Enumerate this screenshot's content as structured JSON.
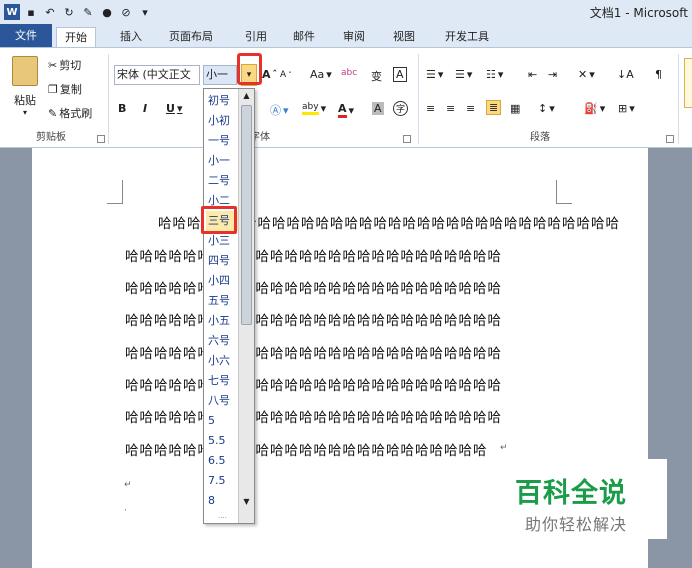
{
  "window": {
    "title": "文档1 - Microsoft"
  },
  "tabs": [
    "文件",
    "开始",
    "插入",
    "页面布局",
    "引用",
    "邮件",
    "审阅",
    "视图",
    "开发工具"
  ],
  "clipboard": {
    "paste": "粘贴",
    "cut": "剪切",
    "copy": "复制",
    "format_painter": "格式刷",
    "group": "剪贴板"
  },
  "font": {
    "name": "宋体 (中文正文",
    "size": "小一",
    "group": "字体",
    "grow": "A",
    "shrink": "A",
    "case": "Aa",
    "pinyin": "abc",
    "phonetic": "变",
    "border_char": "A",
    "bold": "B",
    "italic": "I",
    "underline": "U",
    "abc_letters": "abc",
    "highlight": "aby",
    "font_color": "A",
    "shade_char": "A",
    "enclose": "字"
  },
  "paragraph": {
    "group": "段落"
  },
  "size_options": [
    "初号",
    "小初",
    "一号",
    "小一",
    "二号",
    "小二",
    "三号",
    "小三",
    "四号",
    "小四",
    "五号",
    "小五",
    "六号",
    "小六",
    "七号",
    "八号",
    "5",
    "5.5",
    "6.5",
    "7.5",
    "8"
  ],
  "document": {
    "line_first": "哈哈哈",
    "lines": [
      "哈哈哈哈哈哈哈哈哈哈哈哈哈哈哈哈哈哈哈哈哈哈哈哈哈哈",
      "哈哈哈哈哈哈哈哈哈哈哈哈哈哈哈哈哈哈哈哈哈哈哈哈哈哈",
      "哈哈哈哈哈哈哈哈哈哈哈哈哈哈哈哈哈哈哈哈哈哈哈哈哈哈",
      "哈哈哈哈哈哈哈哈哈哈哈哈哈哈哈哈哈哈哈哈哈哈哈哈哈哈",
      "哈哈哈哈哈哈哈哈哈哈哈哈哈哈哈哈哈哈哈哈哈哈哈哈哈哈",
      "哈哈哈哈哈哈哈哈哈哈哈哈哈哈哈哈哈哈哈哈哈哈哈哈哈哈",
      "哈哈哈哈哈哈哈哈哈哈哈哈哈哈哈哈哈哈哈哈哈哈哈哈哈哈",
      "哈哈哈哈哈哈哈哈哈哈哈哈哈哈哈哈哈哈哈哈哈哈哈哈哈"
    ],
    "para_mark": "↵"
  },
  "watermark": {
    "brand": "百科全说",
    "sub": "助你轻松解决"
  },
  "colors": {
    "file_tab": "#2b579a",
    "accent_red": "#e5322d",
    "brand_green": "#1a9c48"
  }
}
